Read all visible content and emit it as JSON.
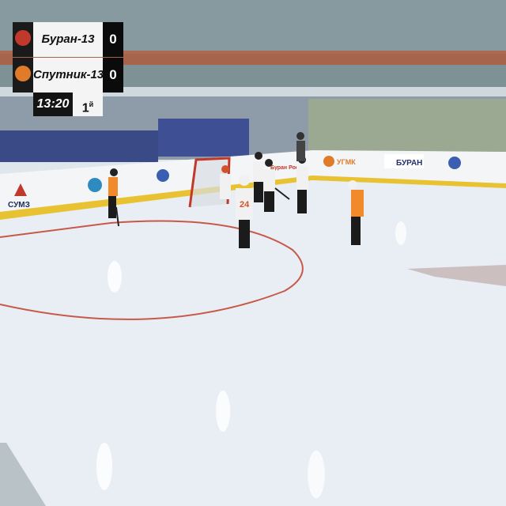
{
  "scoreboard": {
    "home": {
      "name": "Буран-13",
      "score": "0",
      "logo_color": "#c0392b"
    },
    "away": {
      "name": "Спутник-13",
      "score": "0",
      "logo_color": "#e07b2a"
    },
    "clock": "13:20",
    "period": "1",
    "period_suffix": "й"
  },
  "rink_boards": {
    "sponsors": [
      "СУМЗ",
      "Буран Россия",
      "УГМК",
      "БУРАН"
    ]
  },
  "colors": {
    "ice": "#e8eef3",
    "board_white": "#f3f5f7",
    "board_trim": "#e8c230",
    "seats": "#3a4a86",
    "jersey_orange": "#f08a2a",
    "jersey_white": "#f1f1f1",
    "red_line": "#c8584a"
  },
  "players": [
    {
      "jersey": "orange"
    },
    {
      "jersey": "white",
      "number": "24"
    },
    {
      "jersey": "white"
    },
    {
      "jersey": "white"
    },
    {
      "jersey": "white"
    },
    {
      "jersey": "orange"
    },
    {
      "jersey": "white"
    }
  ]
}
